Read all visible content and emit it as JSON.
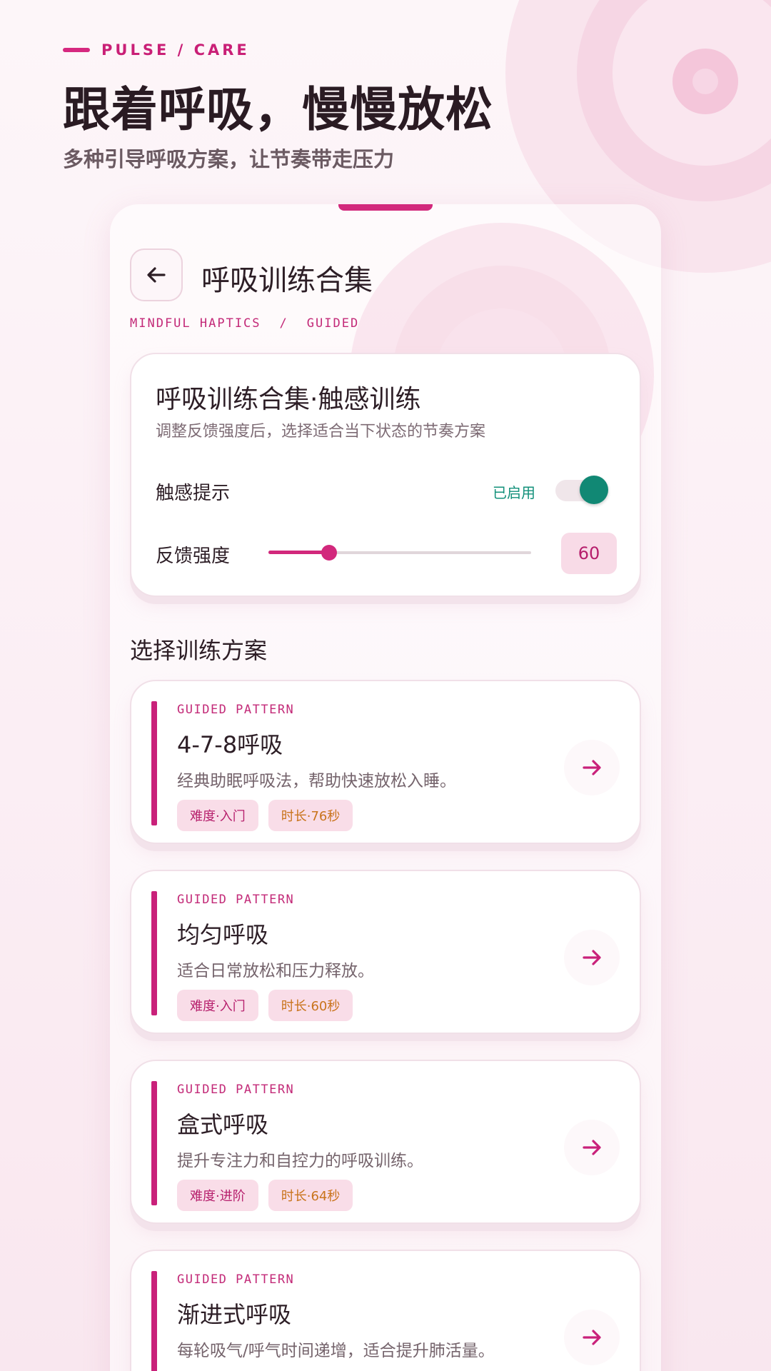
{
  "brand": {
    "text": "PULSE / CARE"
  },
  "hero": {
    "title": "跟着呼吸，慢慢放松",
    "subtitle": "多种引导呼吸方案，让节奏带走压力"
  },
  "header": {
    "title": "呼吸训练合集",
    "breadcrumb": [
      "MINDFUL HAPTICS",
      "/",
      "GUIDED"
    ]
  },
  "settings": {
    "title": "呼吸训练合集·触感训练",
    "subtitle": "调整反馈强度后，选择适合当下状态的节奏方案",
    "haptic_label": "触感提示",
    "haptic_status": "已启用",
    "haptic_enabled": true,
    "strength_label": "反馈强度",
    "strength_value": "60",
    "strength_fraction": 0.23
  },
  "plans_section": {
    "title": "选择训练方案"
  },
  "plans": [
    {
      "tag": "GUIDED PATTERN",
      "name": "4-7-8呼吸",
      "desc": "经典助眠呼吸法，帮助快速放松入睡。",
      "difficulty": "难度·入门",
      "duration": "时长·76秒"
    },
    {
      "tag": "GUIDED PATTERN",
      "name": "均匀呼吸",
      "desc": "适合日常放松和压力释放。",
      "difficulty": "难度·入门",
      "duration": "时长·60秒"
    },
    {
      "tag": "GUIDED PATTERN",
      "name": "盒式呼吸",
      "desc": "提升专注力和自控力的呼吸训练。",
      "difficulty": "难度·进阶",
      "duration": "时长·64秒"
    },
    {
      "tag": "GUIDED PATTERN",
      "name": "渐进式呼吸",
      "desc": "每轮吸气/呼气时间递增，适合提升肺活量。",
      "difficulty": "",
      "duration": ""
    }
  ],
  "colors": {
    "accent": "#d2287c",
    "success": "#118874",
    "duration": "#c9741c"
  },
  "icons": {
    "back": "arrow-left-icon",
    "go": "arrow-right-icon"
  }
}
